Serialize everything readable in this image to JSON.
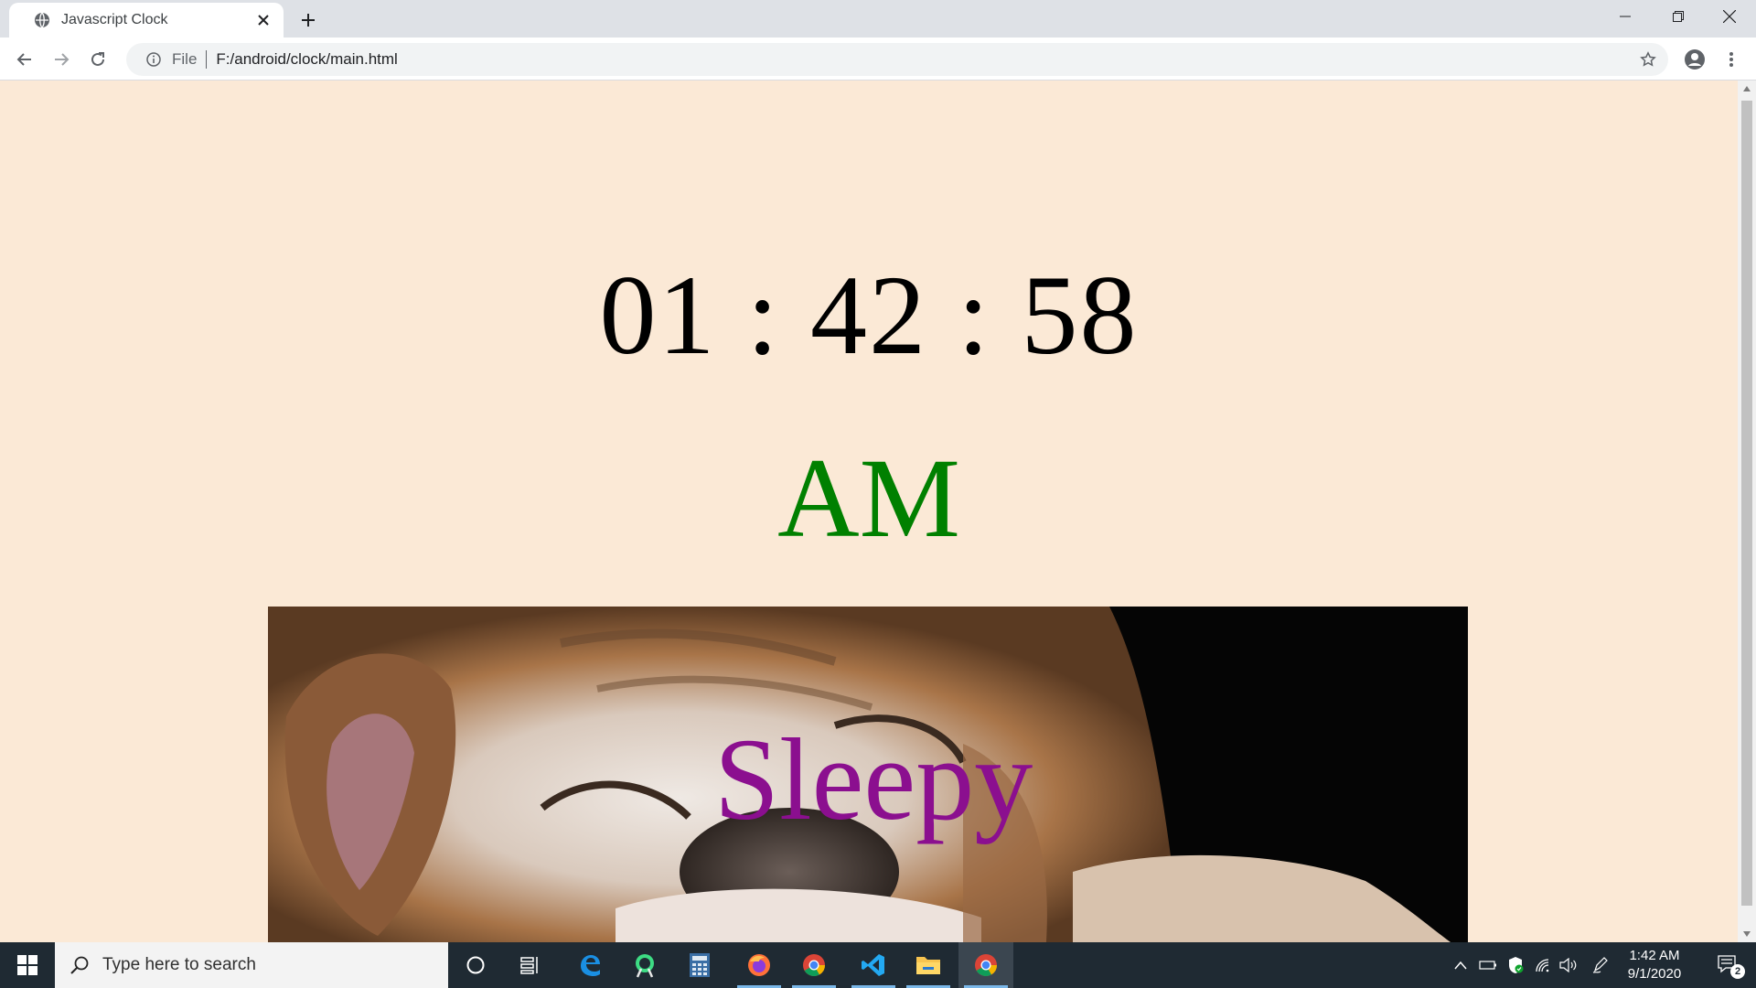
{
  "browser": {
    "tab_title": "Javascript Clock",
    "omnibox_file_label": "File",
    "url": "F:/android/clock/main.html"
  },
  "page": {
    "time": "01 : 42 : 58",
    "period": "AM",
    "mood": "Sleepy",
    "colors": {
      "background": "#fbe9d6",
      "period": "#008000",
      "mood": "#8b0f8f"
    }
  },
  "taskbar": {
    "search_placeholder": "Type here to search",
    "clock_time": "1:42 AM",
    "clock_date": "9/1/2020",
    "notification_count": "2",
    "pinned_icons": [
      "cortana-icon",
      "task-view-icon",
      "edge-icon",
      "android-studio-icon",
      "calculator-icon",
      "firefox-icon",
      "chrome-icon",
      "vscode-icon",
      "file-explorer-icon",
      "chrome-active-icon"
    ]
  }
}
